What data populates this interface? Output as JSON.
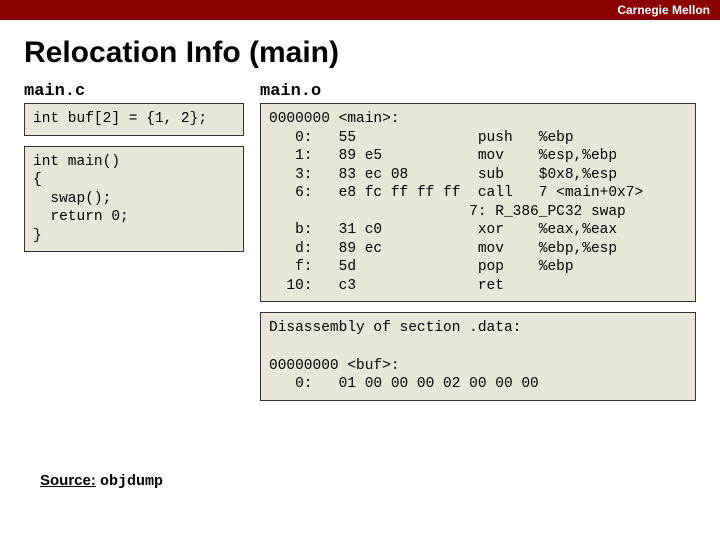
{
  "header": {
    "org": "Carnegie Mellon"
  },
  "title": "Relocation Info (main)",
  "left": {
    "filename": "main.c",
    "code_decl": "int buf[2] = {1, 2};",
    "code_main": "int main()\n{\n  swap();\n  return 0;\n}"
  },
  "right": {
    "filename": "main.o",
    "disasm_text": "0000000 <main>:\n   0:   55              push   %ebp\n   1:   89 e5           mov    %esp,%ebp\n   3:   83 ec 08        sub    $0x8,%esp\n   6:   e8 fc ff ff ff  call   7 <main+0x7>\n                       7: R_386_PC32 swap\n   b:   31 c0           xor    %eax,%eax\n   d:   89 ec           mov    %ebp,%esp\n   f:   5d              pop    %ebp\n  10:   c3              ret",
    "data_section": "Disassembly of section .data:\n\n00000000 <buf>:\n   0:   01 00 00 00 02 00 00 00"
  },
  "footer": {
    "source_label": "Source:",
    "source_val": "objdump"
  }
}
